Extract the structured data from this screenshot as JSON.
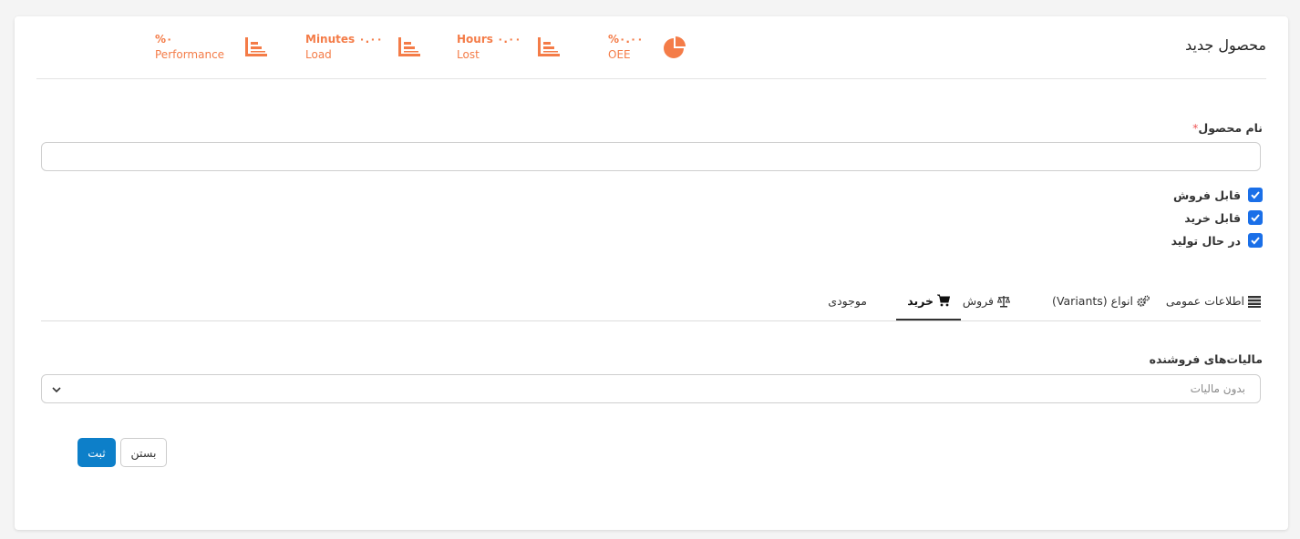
{
  "header": {
    "title": "محصول جدید",
    "stats": [
      {
        "id": "performance",
        "value": "%۰",
        "label": "Performance",
        "icon": "bar-chart-icon"
      },
      {
        "id": "load",
        "value": "Minutes ۰.۰۰",
        "label": "Load",
        "icon": "bar-chart-icon"
      },
      {
        "id": "lost",
        "value": "Hours ۰.۰۰",
        "label": "Lost",
        "icon": "bar-chart-icon"
      },
      {
        "id": "oee",
        "value": "%۰.۰۰",
        "label": "OEE",
        "icon": "pie-chart-icon"
      }
    ]
  },
  "form": {
    "product_name": {
      "label": "نام محصول",
      "required_mark": "*",
      "value": ""
    },
    "checkboxes": [
      {
        "label": "قابل فروش",
        "checked": true
      },
      {
        "label": "قابل خرید",
        "checked": true
      },
      {
        "label": "در حال تولید",
        "checked": true
      }
    ]
  },
  "tabs": [
    {
      "label": "اطلاعات عمومی",
      "icon": "list-icon",
      "active": false
    },
    {
      "label": "انواع (Variants)",
      "icon": "cogs-icon",
      "active": false
    },
    {
      "label": "فروش",
      "icon": "balance-scale-icon",
      "active": false
    },
    {
      "label": "خرید",
      "icon": "shopping-cart-icon",
      "active": true
    },
    {
      "label": "موجودی",
      "icon": "",
      "active": false
    }
  ],
  "purchase": {
    "vendor_taxes": {
      "label": "مالیات‌های فروشنده",
      "selected": "بدون مالیات"
    }
  },
  "actions": {
    "save_label": "ثبت",
    "close_label": "بستن"
  },
  "colors": {
    "accent": "#f47c48",
    "primary": "#0d7fc9",
    "checkbox": "#1a6fe8"
  }
}
